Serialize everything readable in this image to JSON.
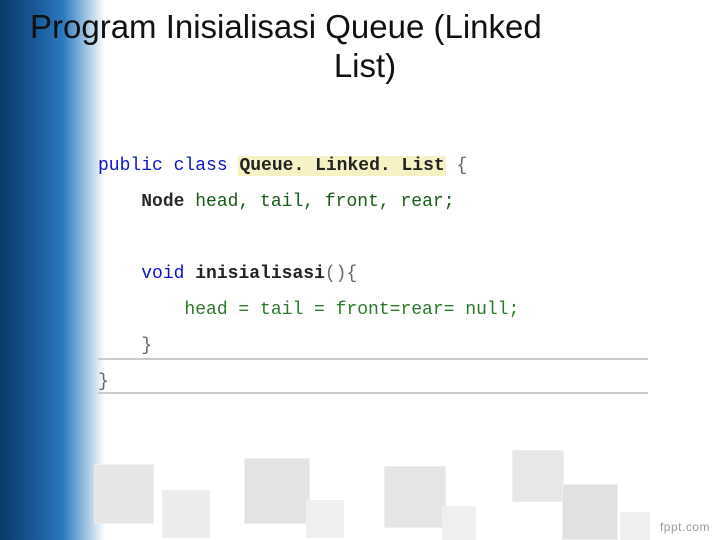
{
  "title": {
    "line1": "Program Inisialisasi Queue (Linked",
    "line2": "List)"
  },
  "code": {
    "kw_public": "public",
    "kw_class": "class",
    "class_name": "Queue. Linked. List",
    "open_brace": "{",
    "node_type": "Node",
    "fields": "head, tail, front, rear;",
    "kw_void": "void",
    "method_name": "inisialisasi",
    "method_parens": "(){",
    "method_body": "head = tail = front=rear= null;",
    "close_brace_method": "}",
    "close_brace_class": "}"
  },
  "footer": {
    "fppt": "fppt.com"
  }
}
